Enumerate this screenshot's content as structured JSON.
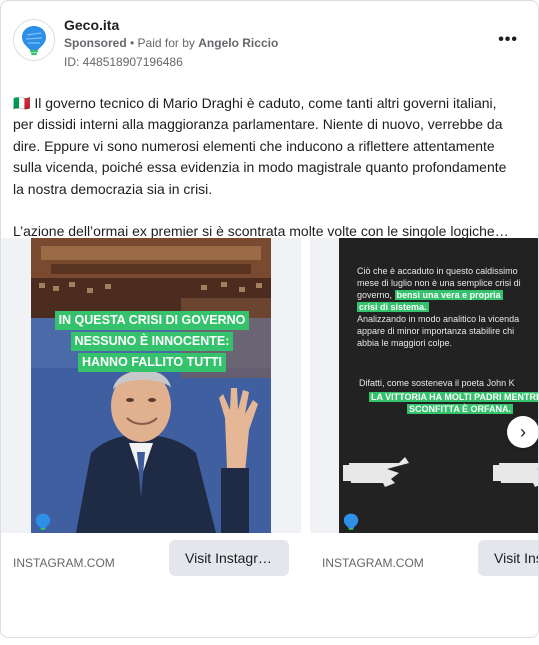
{
  "post": {
    "page_name": "Geco.ita",
    "sponsored_label": "Sponsored",
    "paid_prefix": "• Paid for by",
    "sponsor_name": "Angelo Riccio",
    "ad_id": "ID: 448518907196486",
    "more_label": "•••",
    "body_paragraph_1": "🇮🇹 Il governo tecnico di Mario Draghi è caduto, come tanti altri governi italiani, per dissidi interni alla maggioranza parlamentare. Niente di nuovo, verrebbe da dire. Eppure vi sono numerosi elementi che inducono a riflettere attentamente sulla vicenda, poiché essa evidenzia in modo magistrale quanto profondamente la nostra democrazia sia in crisi.",
    "body_paragraph_2": "L’azione dell’ormai ex premier si è scontrata molte volte con le singole logiche…"
  },
  "carousel": {
    "cards": [
      {
        "headline_line1": "IN QUESTA CRISI DI GOVERNO",
        "headline_line2": "NESSUNO È INNOCENTE:",
        "headline_line3": "HANNO FALLITO TUTTI",
        "domain": "INSTAGRAM.COM",
        "cta_label": "Visit Instagr…"
      },
      {
        "text_1": "Ciò che è accaduto in questo caldissimo",
        "text_2": "mese di luglio non è una semplice crisi di",
        "text_3": "governo,",
        "text_3_highlight": "bensì una vera e propria",
        "text_4_highlight": "crisi di sistema.",
        "text_5": "Analizzando in modo analitico la vicenda",
        "text_6": "appare di minor importanza stabilire chi",
        "text_7": "abbia le maggiori colpe.",
        "text_8": "Difatti, come sosteneva il poeta John K",
        "text_9_highlight": "LA VITTORIA HA MOLTI PADRI MENTRE",
        "text_10_highlight": "SCONFITTA È ORFANA.",
        "domain": "INSTAGRAM.COM",
        "cta_label": "Visit Ins"
      }
    ],
    "next_icon": "chevron-right-icon"
  },
  "colors": {
    "accent_green": "#35c26c",
    "avatar_blue": "#2e8fe6",
    "muted_text": "#65676b",
    "cta_bg": "#e4e6eb"
  }
}
